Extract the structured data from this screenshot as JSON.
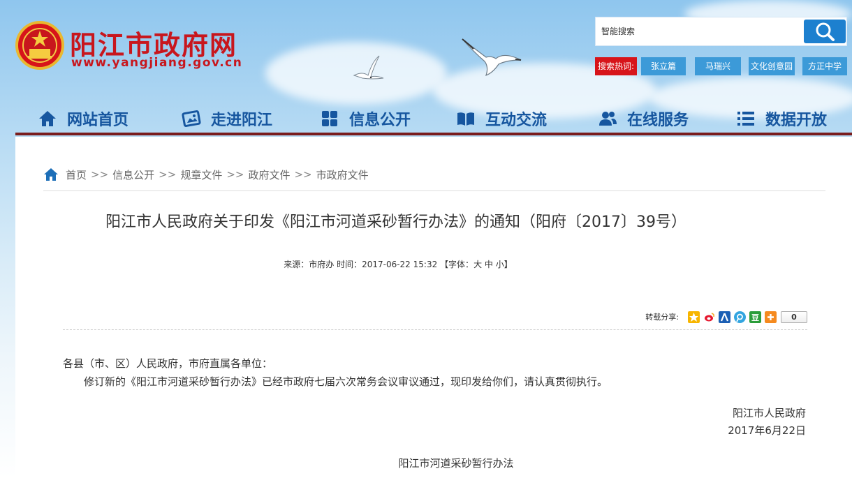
{
  "header": {
    "site_name": "阳江市政府网",
    "site_url": "www.yangjiang.gov.cn",
    "search": {
      "placeholder": "智能搜索"
    },
    "hotwords_label": "搜索热词:",
    "hotwords": [
      "张立篇",
      "马瑞兴",
      "文化创意园",
      "方正中学"
    ]
  },
  "nav": {
    "items": [
      {
        "label": "网站首页",
        "icon": "home-icon"
      },
      {
        "label": "走进阳江",
        "icon": "picture-icon"
      },
      {
        "label": "信息公开",
        "icon": "grid-icon"
      },
      {
        "label": "互动交流",
        "icon": "book-icon"
      },
      {
        "label": "在线服务",
        "icon": "users-icon"
      },
      {
        "label": "数据开放",
        "icon": "list-icon"
      }
    ]
  },
  "breadcrumb": {
    "items": [
      "首页",
      "信息公开",
      "规章文件",
      "政府文件",
      "市政府文件"
    ],
    "separator": ">>"
  },
  "article": {
    "title": "阳江市人民政府关于印发《阳江市河道采砂暂行办法》的通知（阳府〔2017〕39号）",
    "meta": {
      "source_label": "来源：",
      "source": "市府办",
      "time_label": "时间：",
      "time": "2017-06-22 15:32",
      "font_label": "【字体：",
      "font_large": "大",
      "font_medium": "中",
      "font_small": "小",
      "font_end": "】"
    },
    "share": {
      "label": "转载分享:",
      "icons": [
        "qzone-icon",
        "weibo-icon",
        "renren-icon",
        "tqq-icon",
        "douban-icon",
        "more-share-icon"
      ],
      "count": "0"
    },
    "salutation": "各县（市、区）人民政府，市府直属各单位：",
    "paragraph": "修订新的《阳江市河道采砂暂行办法》已经市政府七届六次常务会议审议通过，现印发给你们，请认真贯彻执行。",
    "signer": "阳江市人民政府",
    "date": "2017年6月22日",
    "attachment_title": "阳江市河道采砂暂行办法"
  },
  "colors": {
    "brand_red": "#c8161d",
    "nav_blue": "#16569f",
    "hotword_blue": "#3c9ad8",
    "search_blue": "#1d80cf",
    "nav_rule": "#7a1d1d"
  }
}
